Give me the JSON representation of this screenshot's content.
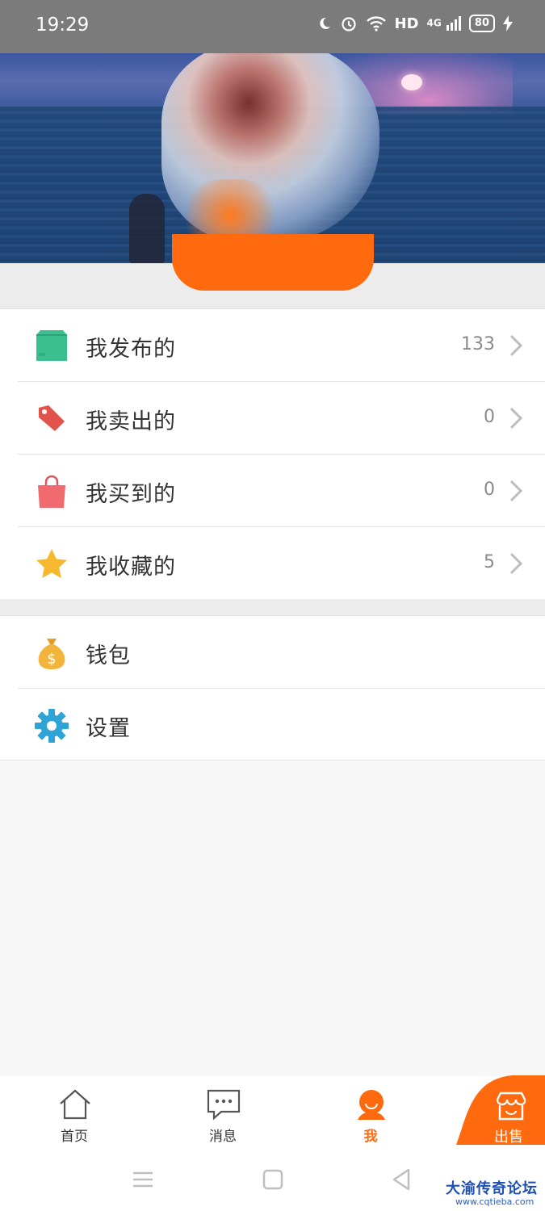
{
  "status_bar": {
    "time": "19:29",
    "network": "HD",
    "signal_label": "4G",
    "battery": "80"
  },
  "menu_main": [
    {
      "label": "我发布的",
      "count": "133",
      "icon": "box-icon",
      "color": "#3cbf8f"
    },
    {
      "label": "我卖出的",
      "count": "0",
      "icon": "tag-icon",
      "color": "#e2544b"
    },
    {
      "label": "我买到的",
      "count": "0",
      "icon": "shopping-bag-icon",
      "color": "#f06a70"
    },
    {
      "label": "我收藏的",
      "count": "5",
      "icon": "star-icon",
      "color": "#f5b82e"
    }
  ],
  "menu_secondary": [
    {
      "label": "钱包",
      "icon": "money-bag-icon",
      "color": "#f2b43a"
    },
    {
      "label": "设置",
      "icon": "gear-icon",
      "color": "#2ea4d6"
    }
  ],
  "tabbar": {
    "tabs": [
      {
        "label": "首页",
        "icon": "home-icon"
      },
      {
        "label": "消息",
        "icon": "message-icon"
      },
      {
        "label": "我",
        "icon": "profile-icon",
        "active": true
      }
    ],
    "sell": {
      "label": "出售",
      "icon": "store-icon",
      "color": "#ff6a0e"
    }
  },
  "watermark": {
    "title": "大渝传奇论坛",
    "url": "www.cqtieba.com"
  },
  "theme": {
    "accent": "#ff6a0e"
  }
}
